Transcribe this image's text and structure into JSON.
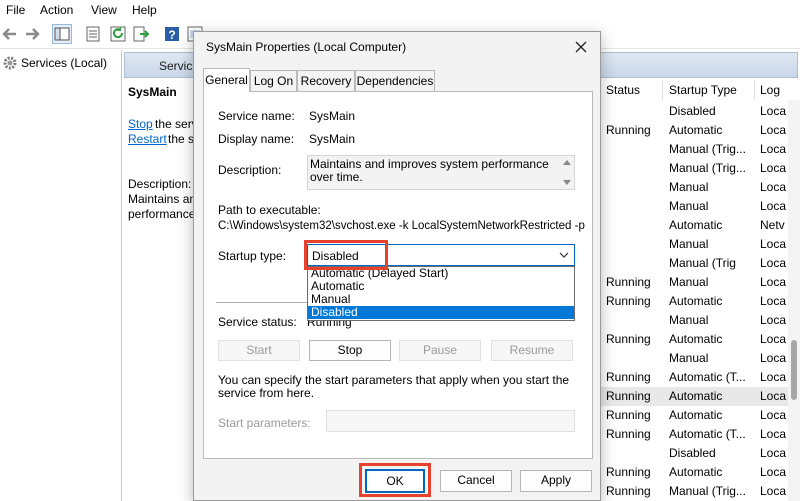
{
  "menu": [
    "File",
    "Action",
    "View",
    "Help"
  ],
  "tree": {
    "item_label": "Services (Local)"
  },
  "pane_header": {
    "title": "Services"
  },
  "extended": {
    "title": "SysMain",
    "stop_link": "Stop",
    "stop_rest": "the serv",
    "restart_link": "Restart",
    "restart_rest": "the se",
    "desc_lines": [
      "Description:",
      "Maintains an",
      "performance"
    ]
  },
  "columns": {
    "status": "Status",
    "startup_type": "Startup Type",
    "log_on": "Log"
  },
  "services": [
    {
      "status": "",
      "startup": "Disabled",
      "logon": "Loca"
    },
    {
      "status": "Running",
      "startup": "Automatic",
      "logon": "Loca"
    },
    {
      "status": "",
      "startup": "Manual (Trig...",
      "logon": "Loca"
    },
    {
      "status": "",
      "startup": "Manual (Trig...",
      "logon": "Loca"
    },
    {
      "status": "",
      "startup": "Manual",
      "logon": "Loca"
    },
    {
      "status": "",
      "startup": "Manual",
      "logon": "Loca"
    },
    {
      "status": "",
      "startup": "Automatic",
      "logon": "Netv"
    },
    {
      "status": "",
      "startup": "Manual",
      "logon": "Loca"
    },
    {
      "status": "",
      "startup": "Manual (Trig",
      "logon": "Loca"
    },
    {
      "status": "Running",
      "startup": "Manual",
      "logon": "Loca"
    },
    {
      "status": "Running",
      "startup": "Automatic",
      "logon": "Loca"
    },
    {
      "status": "",
      "startup": "Manual",
      "logon": "Loca"
    },
    {
      "status": "Running",
      "startup": "Automatic",
      "logon": "Loca"
    },
    {
      "status": "",
      "startup": "Manual",
      "logon": "Loca"
    },
    {
      "status": "Running",
      "startup": "Automatic (T...",
      "logon": "Loca"
    },
    {
      "status": "Running",
      "startup": "Automatic",
      "logon": "Loca"
    },
    {
      "status": "Running",
      "startup": "Automatic",
      "logon": "Loca"
    },
    {
      "status": "Running",
      "startup": "Automatic (T...",
      "logon": "Loca"
    },
    {
      "status": "",
      "startup": "Disabled",
      "logon": "Loca"
    },
    {
      "status": "Running",
      "startup": "Automatic",
      "logon": "Loca"
    },
    {
      "status": "Running",
      "startup": "Manual (Trig...",
      "logon": "Loca"
    }
  ],
  "selected_row": 15,
  "dialog": {
    "title": "SysMain Properties (Local Computer)",
    "tabs": [
      "General",
      "Log On",
      "Recovery",
      "Dependencies"
    ],
    "active_tab": "General",
    "service_name_label": "Service name:",
    "service_name": "SysMain",
    "display_name_label": "Display name:",
    "display_name": "SysMain",
    "description_label": "Description:",
    "description": "Maintains and improves system performance over time.",
    "path_label": "Path to executable:",
    "path": "C:\\Windows\\system32\\svchost.exe -k LocalSystemNetworkRestricted -p",
    "startup_type_label": "Startup type:",
    "startup_type_value": "Disabled",
    "startup_options": [
      "Automatic (Delayed Start)",
      "Automatic",
      "Manual",
      "Disabled"
    ],
    "startup_selected_option": "Disabled",
    "service_status_label": "Service status:",
    "service_status": "Running",
    "start_label": "Start",
    "stop_label": "Stop",
    "pause_label": "Pause",
    "resume_label": "Resume",
    "params_hint": "You can specify the start parameters that apply when you start the service from here.",
    "start_params_label": "Start parameters:",
    "start_params_value": "",
    "ok_label": "OK",
    "cancel_label": "Cancel",
    "apply_label": "Apply"
  },
  "colors": {
    "highlight_box": "#e8422f",
    "selection_blue": "#0078d7",
    "link": "#0066cc"
  }
}
